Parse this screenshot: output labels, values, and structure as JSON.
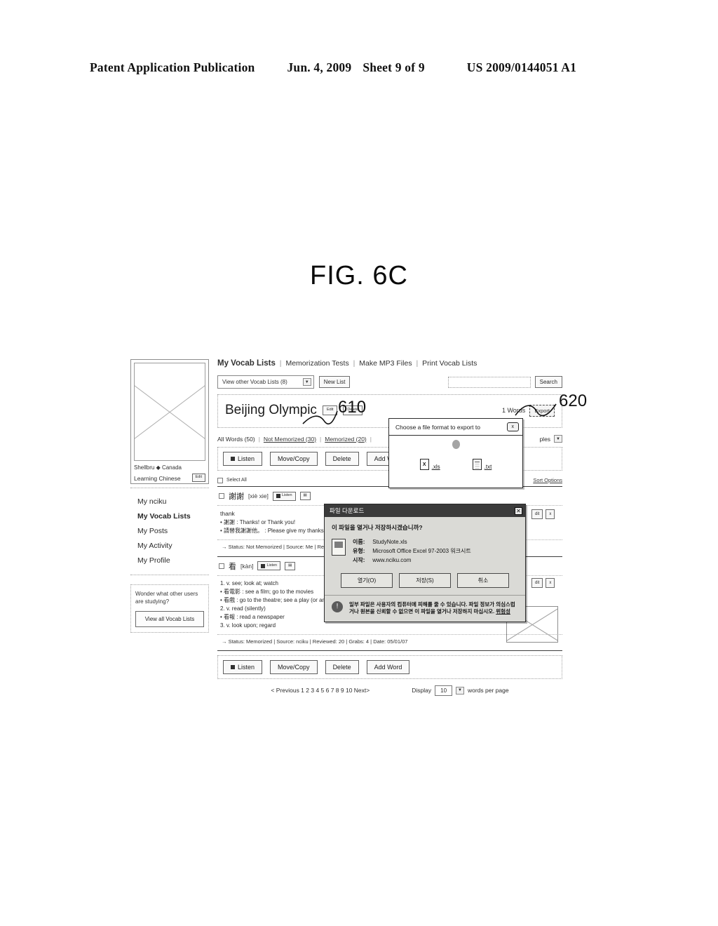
{
  "patent_header": {
    "publication": "Patent Application Publication",
    "date": "Jun. 4, 2009",
    "sheet": "Sheet 9 of 9",
    "number": "US 2009/0144051 A1"
  },
  "figure": {
    "label": "FIG. 6C",
    "reference_numerals": [
      "610",
      "620"
    ]
  },
  "sidebar": {
    "profile": {
      "name": "Shellbru ◆ Canada",
      "status": "Learning Chinese",
      "edit_label": "Edit"
    },
    "nav_items": [
      {
        "label": "My nciku",
        "active": false
      },
      {
        "label": "My Vocab Lists",
        "active": true
      },
      {
        "label": "My Posts",
        "active": false
      },
      {
        "label": "My Activity",
        "active": false
      },
      {
        "label": "My Profile",
        "active": false
      }
    ],
    "promo": {
      "text": "Wonder what other users are studying?",
      "button": "View all Vocab Lists"
    }
  },
  "topnav": {
    "current": "My Vocab Lists",
    "links": [
      "Memorization Tests",
      "Make MP3 Files",
      "Print Vocab Lists"
    ]
  },
  "controls": {
    "view_other_lists": "View other Vocab Lists (8)",
    "new_list": "New List",
    "search_placeholder": "",
    "search_button": "Search"
  },
  "list_panel": {
    "title": "Beijing Olympic",
    "edit": "Edit",
    "delete": "Delete",
    "word_count": "1 Words",
    "export": "Export"
  },
  "filters": {
    "all": "All Words (50)",
    "not_memorized": "Not Memorized (30)",
    "memorized": "Memorized (20)",
    "examples": "ples",
    "sort_options": "Sort Options"
  },
  "toolbar": {
    "listen": "Listen",
    "move_copy": "Move/Copy",
    "delete": "Delete",
    "add_word": "Add Word"
  },
  "select_all": "Select All",
  "words": [
    {
      "hanzi": "謝謝",
      "pinyin": "[xiè xie]",
      "listen": "Listen",
      "english": "thank",
      "definitions": [
        "• 謝謝 : Thanks! or Thank you!",
        "• 請替我謝謝他。 : Please give my thanks to him"
      ],
      "status": "→ Status: Not Memorized | Source: Me | Revi"
    },
    {
      "hanzi": "看",
      "pinyin": "[kàn]",
      "listen": "Listen",
      "definitions": [
        "1. v. see; look at; watch",
        "• 看電影 : see a film; go to the movies",
        "• 看戲 : go to the theatre; see a play (or an opera",
        "2. v. read (silently)",
        "• 看報 : read a newspaper",
        "3. v. look upon; regard"
      ],
      "status": "→ Status: Memorized | Source: nciku | Reviewed: 20 | Grabs: 4 | Date: 05/01/07"
    }
  ],
  "footer": {
    "pagination": "< Previous 1 2 3 4 5 6 7 8 9 10 Next>",
    "display_label": "Display",
    "display_value": "10",
    "per_page_label": "words per page"
  },
  "export_popup": {
    "title": "Choose a file format to export to",
    "close": "x",
    "formats": [
      {
        "icon": "xls-file-icon",
        "label": ".xls",
        "glyph": "X"
      },
      {
        "icon": "txt-file-icon",
        "label": ".txt",
        "glyph": ""
      }
    ]
  },
  "download_dialog": {
    "title": "파일 다운로드",
    "close": "✕",
    "question": "이 파일을 열거나 저장하시겠습니까?",
    "fields": [
      {
        "label": "이름:",
        "value": "StudyNote.xls"
      },
      {
        "label": "유형:",
        "value": "Microsoft Office Excel 97-2003 워크시트"
      },
      {
        "label": "시작:",
        "value": "www.nciku.com"
      }
    ],
    "buttons": [
      "열기(O)",
      "저장(S)",
      "취소"
    ],
    "warning": "일부 파일은 사용자의 컴퓨터에 피해를 줄 수 있습니다. 파일 정보가 의심스럽거나 원본을 신뢰할 수 없으면 이 파일을 열거나 저장하지 마십시오.",
    "warning_link": "위험성"
  }
}
